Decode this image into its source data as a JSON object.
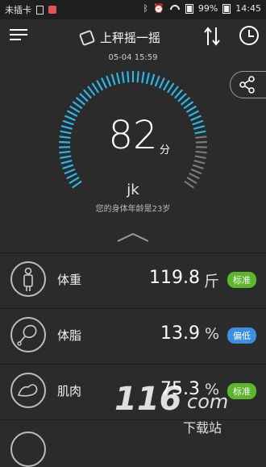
{
  "status_bar": {
    "carrier": "未插卡",
    "battery_percent": "99%",
    "time": "14:45"
  },
  "header": {
    "title": "上秤摇一摇"
  },
  "measurement": {
    "datetime": "05-04 15:59",
    "score": "82",
    "score_unit": "分",
    "username": "jk",
    "body_age_text": "您的身体年龄是23岁"
  },
  "metrics": [
    {
      "label": "体重",
      "value": "119.8",
      "unit": "斤",
      "badge": "标准",
      "badge_color": "#5db52e"
    },
    {
      "label": "体脂",
      "value": "13.9",
      "unit": "%",
      "badge": "偏低",
      "badge_color": "#3a8fe0"
    },
    {
      "label": "肌肉",
      "value": "75.3",
      "unit": "%",
      "badge": "标准",
      "badge_color": "#5db52e"
    }
  ],
  "watermark": {
    "brand": "116",
    "suffix": "com",
    "site": "下载站"
  },
  "colors": {
    "accent_blue": "#2ab6e8",
    "gauge_grey": "#7a7a7a",
    "bg": "#2b2b2b"
  }
}
